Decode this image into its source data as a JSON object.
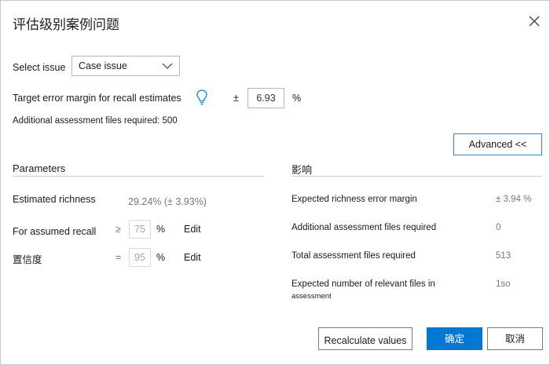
{
  "dialog": {
    "title": "评估级别案例问题",
    "close_icon": "close-icon"
  },
  "select_issue": {
    "label": "Select issue",
    "value": "Case issue"
  },
  "target_margin": {
    "label": "Target error margin for recall estimates",
    "pm": "±",
    "value": "6.93",
    "unit": "%",
    "icon": "lightbulb-icon"
  },
  "additional_files": "Additional assessment files required: 500",
  "advanced_button": "Advanced <<",
  "parameters": {
    "title": "Parameters",
    "richness_label": "Estimated richness",
    "richness_value": "29.24% (± 3.93%)",
    "recall_label": "For assumed recall",
    "recall_op": "≥",
    "recall_value": "75",
    "recall_unit": "%",
    "recall_edit": "Edit",
    "confidence_label": "置信度",
    "confidence_op": "=",
    "confidence_value": "95",
    "confidence_unit": "%",
    "confidence_edit": "Edit"
  },
  "impact": {
    "title": "影响",
    "rows": [
      {
        "label": "Expected richness error margin",
        "value": "± 3.94 %"
      },
      {
        "label": "Additional assessment files required",
        "value": "0"
      },
      {
        "label": "Total assessment files required",
        "value": "513"
      },
      {
        "label": "Expected number of relevant files in",
        "label2": "assessment",
        "value": "1so"
      }
    ]
  },
  "footer": {
    "recalculate": "Recalculate values",
    "ok": "确定",
    "cancel": "取消"
  },
  "colors": {
    "accent": "#0078d4",
    "icon_blue": "#2b88d8"
  }
}
